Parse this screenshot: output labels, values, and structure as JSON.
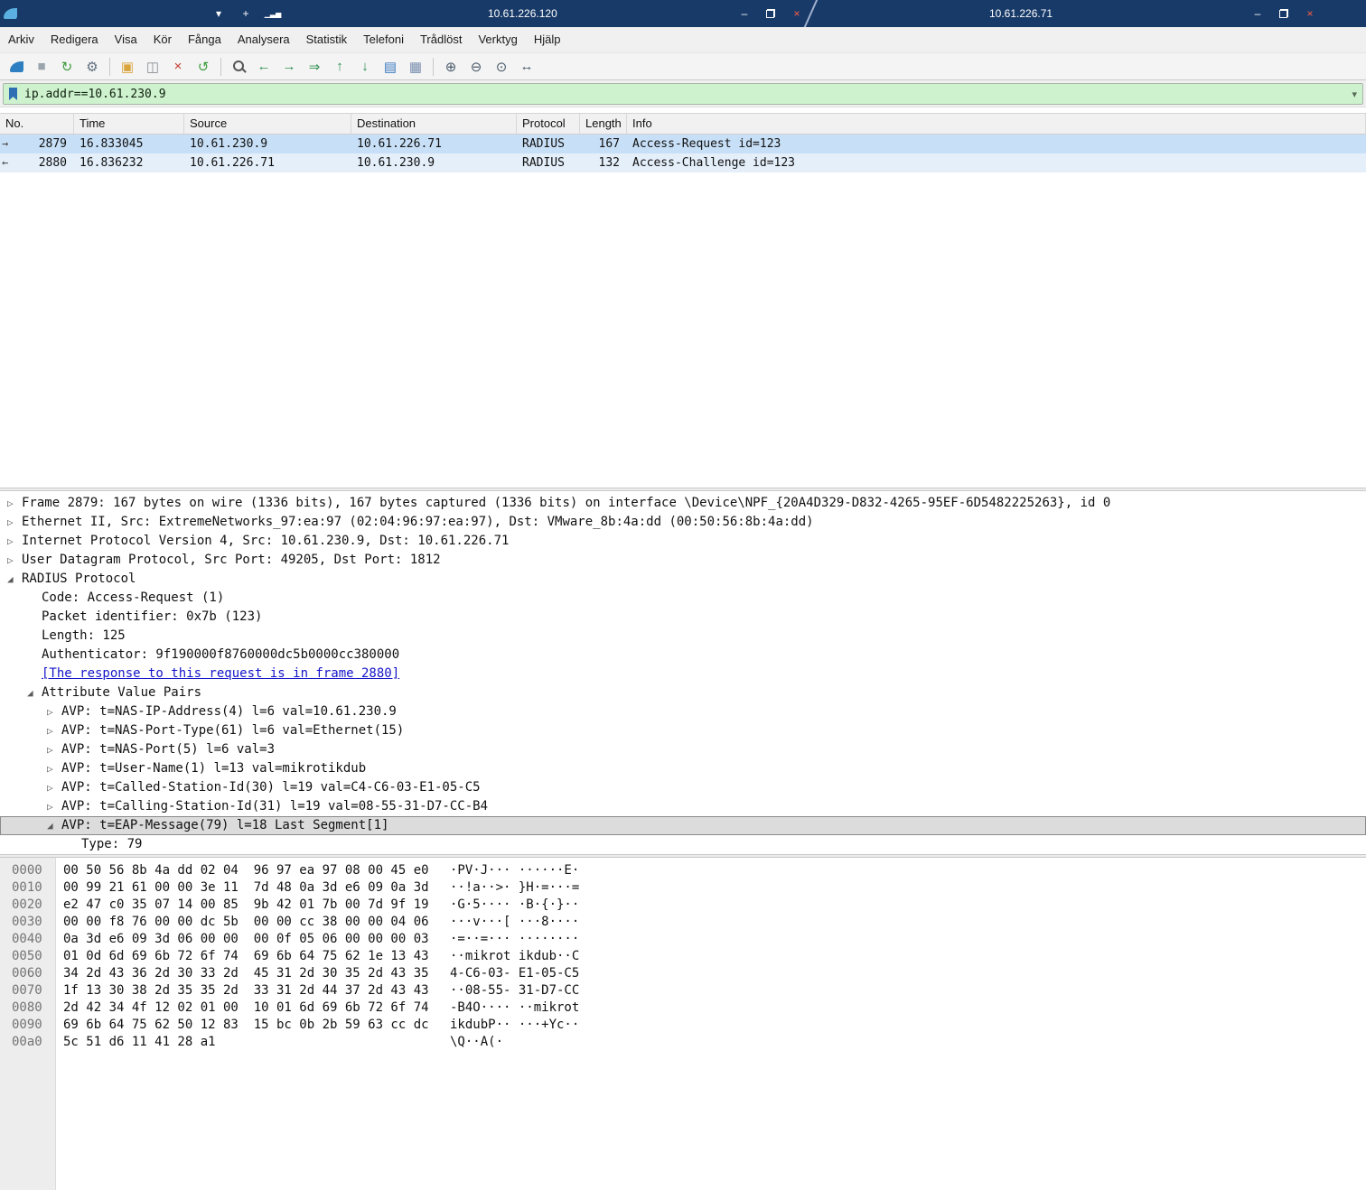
{
  "colors": {
    "titlebar": "#183a68",
    "filter_valid_bg": "#cdf2cd",
    "selected_row": "#c8e0f7",
    "udp_row": "#e4effa",
    "detail_selected": "#dcdcdc",
    "link": "#1414c8"
  },
  "window": {
    "front": {
      "title": "10.61.226.120",
      "controls": [
        {
          "name": "session-dropdown",
          "glyph": "▾",
          "color": "#ffffff"
        },
        {
          "name": "pin",
          "glyph": "+",
          "color": "#ffffff"
        },
        {
          "name": "connection-signal",
          "glyph": "▁▃▅",
          "color": "#ffffff"
        }
      ],
      "buttons": [
        {
          "name": "minimize",
          "glyph": "–",
          "color": "#ffffff"
        },
        {
          "name": "restore",
          "shape": "restore",
          "color": "#ffffff"
        },
        {
          "name": "close",
          "glyph": "×",
          "color": "#ff5c45"
        }
      ]
    },
    "back": {
      "title": "10.61.226.71",
      "buttons": [
        {
          "name": "minimize",
          "glyph": "–",
          "color": "#ffffff"
        },
        {
          "name": "restore",
          "shape": "restore",
          "color": "#ffffff"
        },
        {
          "name": "close",
          "glyph": "×",
          "color": "#ff5c45"
        }
      ]
    }
  },
  "menu": {
    "items": [
      "Arkiv",
      "Redigera",
      "Visa",
      "Kör",
      "Fånga",
      "Analysera",
      "Statistik",
      "Telefoni",
      "Trådlöst",
      "Verktyg",
      "Hjälp"
    ]
  },
  "toolbar": {
    "groups": [
      [
        {
          "name": "start-capture",
          "shape": "fin",
          "color": "#2d7fc1"
        },
        {
          "name": "stop-capture",
          "glyph": "■",
          "color": "#99a4ad"
        },
        {
          "name": "restart-capture",
          "glyph": "↻",
          "color": "#3f9c3f"
        },
        {
          "name": "capture-options",
          "glyph": "⚙",
          "color": "#5f6f7f"
        }
      ],
      [
        {
          "name": "open-file",
          "glyph": "▣",
          "color": "#d9a43b"
        },
        {
          "name": "save-file",
          "glyph": "◫",
          "color": "#8a8f94"
        },
        {
          "name": "close-file",
          "glyph": "×",
          "color": "#c43b2e"
        },
        {
          "name": "reload-file",
          "glyph": "↺",
          "color": "#3f9c3f"
        }
      ],
      [
        {
          "name": "find-packet",
          "shape": "magnifier",
          "color": "#555555"
        },
        {
          "name": "go-back",
          "glyph": "←",
          "color": "#2f8f4f"
        },
        {
          "name": "go-forward",
          "glyph": "→",
          "color": "#2f8f4f"
        },
        {
          "name": "goto-packet",
          "glyph": "⇒",
          "color": "#2f8f4f"
        },
        {
          "name": "go-first",
          "glyph": "↑",
          "color": "#2f8f4f"
        },
        {
          "name": "go-last",
          "glyph": "↓",
          "color": "#2f8f4f"
        },
        {
          "name": "autoscroll",
          "glyph": "▤",
          "color": "#3a7abf"
        },
        {
          "name": "colorize",
          "glyph": "▦",
          "color": "#7a8fb0"
        }
      ],
      [
        {
          "name": "zoom-in",
          "glyph": "⊕",
          "color": "#4a5a6a"
        },
        {
          "name": "zoom-out",
          "glyph": "⊖",
          "color": "#4a5a6a"
        },
        {
          "name": "zoom-100",
          "glyph": "⊙",
          "color": "#4a5a6a"
        },
        {
          "name": "resize-columns",
          "glyph": "↔",
          "color": "#4a5a6a"
        }
      ]
    ]
  },
  "filter": {
    "value": "ip.addr==10.61.230.9",
    "dropdown_glyph": "▾"
  },
  "packet_list": {
    "columns": [
      {
        "key": "no",
        "label": "No."
      },
      {
        "key": "time",
        "label": "Time"
      },
      {
        "key": "source",
        "label": "Source"
      },
      {
        "key": "destination",
        "label": "Destination"
      },
      {
        "key": "protocol",
        "label": "Protocol"
      },
      {
        "key": "length",
        "label": "Length"
      },
      {
        "key": "info",
        "label": "Info"
      }
    ],
    "rows": [
      {
        "no": "2879",
        "time": "16.833045",
        "source": "10.61.230.9",
        "destination": "10.61.226.71",
        "protocol": "RADIUS",
        "length": "167",
        "info": "Access-Request id=123",
        "arrow": "→",
        "selected": true
      },
      {
        "no": "2880",
        "time": "16.836232",
        "source": "10.61.226.71",
        "destination": "10.61.230.9",
        "protocol": "RADIUS",
        "length": "132",
        "info": "Access-Challenge id=123",
        "arrow": "←",
        "selected": false
      }
    ]
  },
  "details": {
    "expander_open": "◢",
    "expander_closed": "▷",
    "lines": [
      {
        "depth": 0,
        "exp": "closed",
        "text": "Frame 2879: 167 bytes on wire (1336 bits), 167 bytes captured (1336 bits) on interface \\Device\\NPF_{20A4D329-D832-4265-95EF-6D5482225263}, id 0"
      },
      {
        "depth": 0,
        "exp": "closed",
        "text": "Ethernet II, Src: ExtremeNetworks_97:ea:97 (02:04:96:97:ea:97), Dst: VMware_8b:4a:dd (00:50:56:8b:4a:dd)"
      },
      {
        "depth": 0,
        "exp": "closed",
        "text": "Internet Protocol Version 4, Src: 10.61.230.9, Dst: 10.61.226.71"
      },
      {
        "depth": 0,
        "exp": "closed",
        "text": "User Datagram Protocol, Src Port: 49205, Dst Port: 1812"
      },
      {
        "depth": 0,
        "exp": "open",
        "text": "RADIUS Protocol"
      },
      {
        "depth": 1,
        "exp": "none",
        "text": "Code: Access-Request (1)"
      },
      {
        "depth": 1,
        "exp": "none",
        "text": "Packet identifier: 0x7b (123)"
      },
      {
        "depth": 1,
        "exp": "none",
        "text": "Length: 125"
      },
      {
        "depth": 1,
        "exp": "none",
        "text": "Authenticator: 9f190000f8760000dc5b0000cc380000"
      },
      {
        "depth": 1,
        "exp": "none",
        "text": "[The response to this request is in frame 2880]",
        "link": true
      },
      {
        "depth": 1,
        "exp": "open",
        "text": "Attribute Value Pairs"
      },
      {
        "depth": 2,
        "exp": "closed",
        "text": "AVP: t=NAS-IP-Address(4) l=6 val=10.61.230.9"
      },
      {
        "depth": 2,
        "exp": "closed",
        "text": "AVP: t=NAS-Port-Type(61) l=6 val=Ethernet(15)"
      },
      {
        "depth": 2,
        "exp": "closed",
        "text": "AVP: t=NAS-Port(5) l=6 val=3"
      },
      {
        "depth": 2,
        "exp": "closed",
        "text": "AVP: t=User-Name(1) l=13 val=mikrotikdub"
      },
      {
        "depth": 2,
        "exp": "closed",
        "text": "AVP: t=Called-Station-Id(30) l=19 val=C4-C6-03-E1-05-C5"
      },
      {
        "depth": 2,
        "exp": "closed",
        "text": "AVP: t=Calling-Station-Id(31) l=19 val=08-55-31-D7-CC-B4"
      },
      {
        "depth": 2,
        "exp": "open",
        "text": "AVP: t=EAP-Message(79) l=18 Last Segment[1]",
        "selected": true
      },
      {
        "depth": 3,
        "exp": "none",
        "text": "Type: 79"
      }
    ]
  },
  "hex": {
    "rows": [
      {
        "offset": "0000",
        "hex": "00 50 56 8b 4a dd 02 04  96 97 ea 97 08 00 45 e0",
        "ascii": "·PV·J··· ······E·"
      },
      {
        "offset": "0010",
        "hex": "00 99 21 61 00 00 3e 11  7d 48 0a 3d e6 09 0a 3d",
        "ascii": "··!a··>· }H·=···="
      },
      {
        "offset": "0020",
        "hex": "e2 47 c0 35 07 14 00 85  9b 42 01 7b 00 7d 9f 19",
        "ascii": "·G·5···· ·B·{·}··"
      },
      {
        "offset": "0030",
        "hex": "00 00 f8 76 00 00 dc 5b  00 00 cc 38 00 00 04 06",
        "ascii": "···v···[ ···8····"
      },
      {
        "offset": "0040",
        "hex": "0a 3d e6 09 3d 06 00 00  00 0f 05 06 00 00 00 03",
        "ascii": "·=··=··· ········"
      },
      {
        "offset": "0050",
        "hex": "01 0d 6d 69 6b 72 6f 74  69 6b 64 75 62 1e 13 43",
        "ascii": "··mikrot ikdub··C"
      },
      {
        "offset": "0060",
        "hex": "34 2d 43 36 2d 30 33 2d  45 31 2d 30 35 2d 43 35",
        "ascii": "4-C6-03- E1-05-C5"
      },
      {
        "offset": "0070",
        "hex": "1f 13 30 38 2d 35 35 2d  33 31 2d 44 37 2d 43 43",
        "ascii": "··08-55- 31-D7-CC"
      },
      {
        "offset": "0080",
        "hex": "2d 42 34 4f 12 02 01 00  10 01 6d 69 6b 72 6f 74",
        "ascii": "-B4O···· ··mikrot"
      },
      {
        "offset": "0090",
        "hex": "69 6b 64 75 62 50 12 83  15 bc 0b 2b 59 63 cc dc",
        "ascii": "ikdubP·· ···+Yc··"
      },
      {
        "offset": "00a0",
        "hex": "5c 51 d6 11 41 28 a1",
        "ascii": "\\Q··A(·"
      }
    ]
  }
}
